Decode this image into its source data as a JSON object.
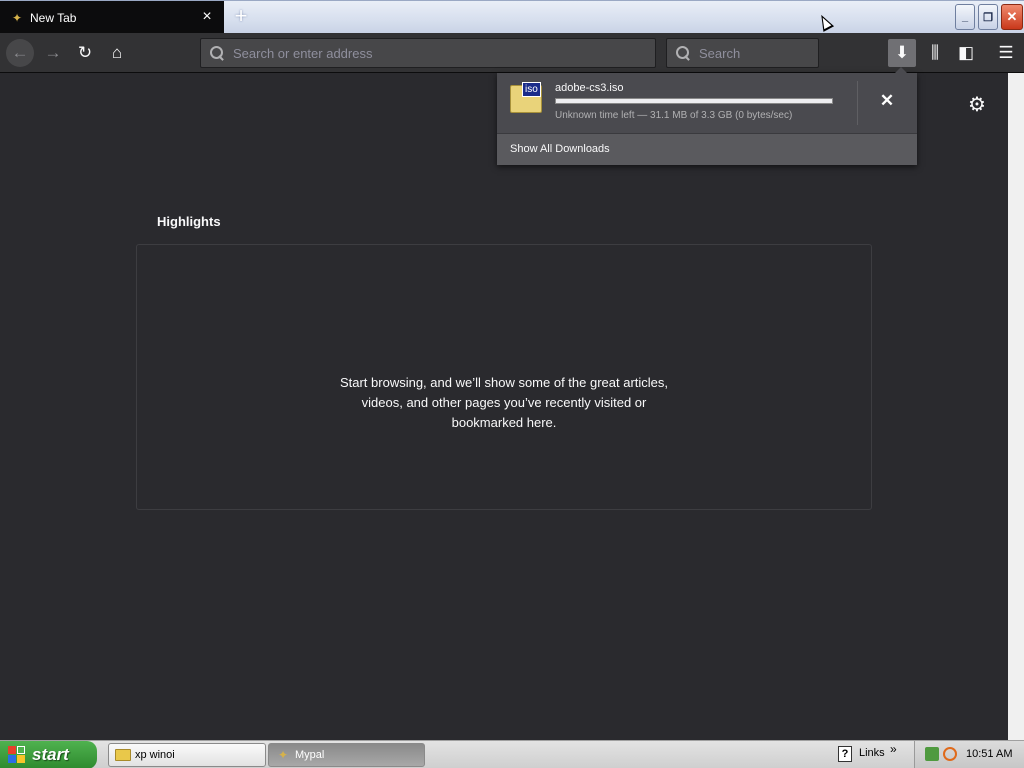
{
  "browser": {
    "tab_title": "New Tab",
    "url_placeholder": "Search or enter address",
    "search_placeholder": "Search"
  },
  "downloads": {
    "filename": "adobe-cs3.iso",
    "file_icon_label": "iso",
    "status": "Unknown time left — 31.1 MB of 3.3 GB (0 bytes/sec)",
    "progress_percent": 100,
    "footer": "Show All Downloads"
  },
  "highlights": {
    "title": "Highlights",
    "message": "Start browsing, and we’ll show some of the great articles, videos, and other pages you’ve recently visited or bookmarked here."
  },
  "taskbar": {
    "start_label": "start",
    "tasks": [
      {
        "label": "xp winoi"
      },
      {
        "label": "Mypal"
      }
    ],
    "links_label": "Links",
    "clock": "10:51 AM"
  },
  "icons": {
    "back": "back-arrow-icon",
    "forward": "forward-arrow-icon",
    "reload": "reload-icon",
    "home": "home-icon",
    "download": "download-icon",
    "library": "library-icon",
    "sidebar": "sidebar-icon",
    "menu": "hamburger-menu-icon",
    "settings": "gear-icon"
  },
  "colors": {
    "content_bg": "#2a2a2e",
    "toolbar_bg": "#323234",
    "panel_bg": "#4a4a4f"
  }
}
